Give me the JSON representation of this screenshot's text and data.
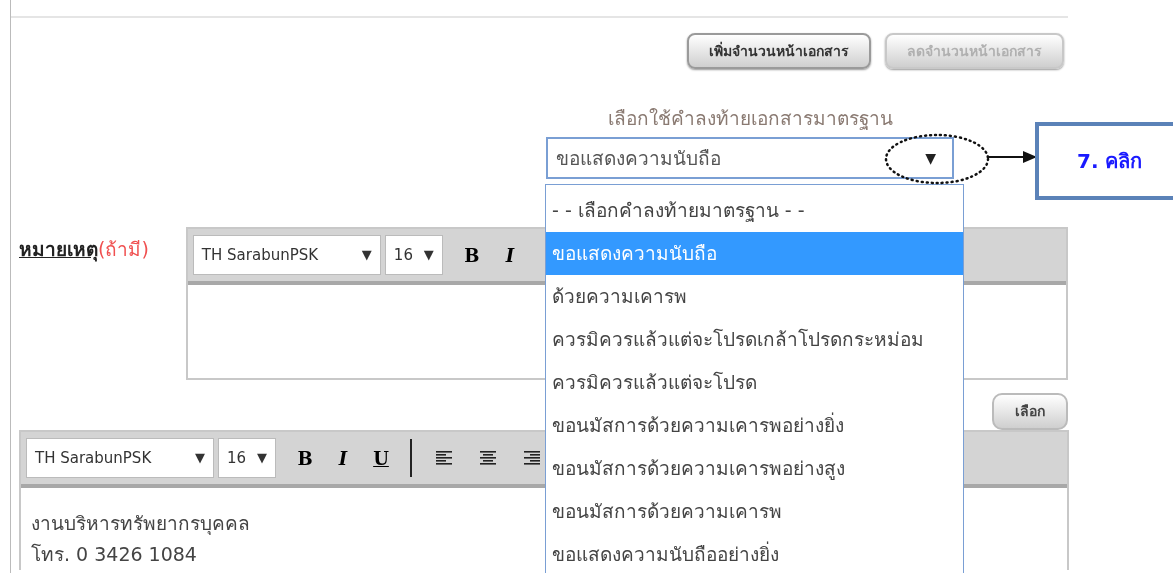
{
  "page_buttons": [
    {
      "label": "เพิ่มจำนวนหน้าเอกสาร",
      "disabled": false
    },
    {
      "label": "ลดจำนวนหน้าเอกสาร",
      "disabled": true
    }
  ],
  "closing": {
    "label": "เลือกใช้คำลงท้ายเอกสารมาตรฐาน",
    "value": "ขอแสดงความนับถือ",
    "arrow": "▼",
    "expanded": true,
    "options": [
      {
        "label": "- - เลือกคำลงท้ายมาตรฐาน - -",
        "selected": false
      },
      {
        "label": "ขอแสดงความนับถือ",
        "selected": true
      },
      {
        "label": "ด้วยความเคารพ",
        "selected": false
      },
      {
        "label": "ควรมิควรแล้วแต่จะโปรดเกล้าโปรดกระหม่อม",
        "selected": false
      },
      {
        "label": "ควรมิควรแล้วแต่จะโปรด",
        "selected": false
      },
      {
        "label": "ขอนมัสการด้วยความเคารพอย่างยิ่ง",
        "selected": false
      },
      {
        "label": "ขอนมัสการด้วยความเคารพอย่างสูง",
        "selected": false
      },
      {
        "label": "ขอนมัสการด้วยความเคารพ",
        "selected": false
      },
      {
        "label": "ขอแสดงความนับถืออย่างยิ่ง",
        "selected": false
      }
    ]
  },
  "note": {
    "label": "หมายเหตุ",
    "hint": "(ถ้ามี)",
    "toolbar": {
      "font": "TH SarabunPSK",
      "size": "16",
      "arrow": "▼",
      "tools": [
        {
          "kind": "bold",
          "label": "B"
        },
        {
          "kind": "italic",
          "label": "I"
        }
      ]
    }
  },
  "choose_button": "เลือก",
  "signature_editor": {
    "toolbar": {
      "font": "TH SarabunPSK",
      "size": "16",
      "arrow": "▼",
      "tools": [
        {
          "kind": "bold",
          "label": "B"
        },
        {
          "kind": "italic",
          "label": "I"
        },
        {
          "kind": "underline",
          "label": "U"
        },
        {
          "kind": "separator"
        },
        {
          "kind": "align-left"
        },
        {
          "kind": "align-center"
        },
        {
          "kind": "align-right"
        }
      ]
    },
    "lines": [
      "งานบริหารทรัพยากรบุคคล",
      "โทร. 0 3426 1084"
    ]
  },
  "callout": {
    "text": "7. คลิก"
  }
}
